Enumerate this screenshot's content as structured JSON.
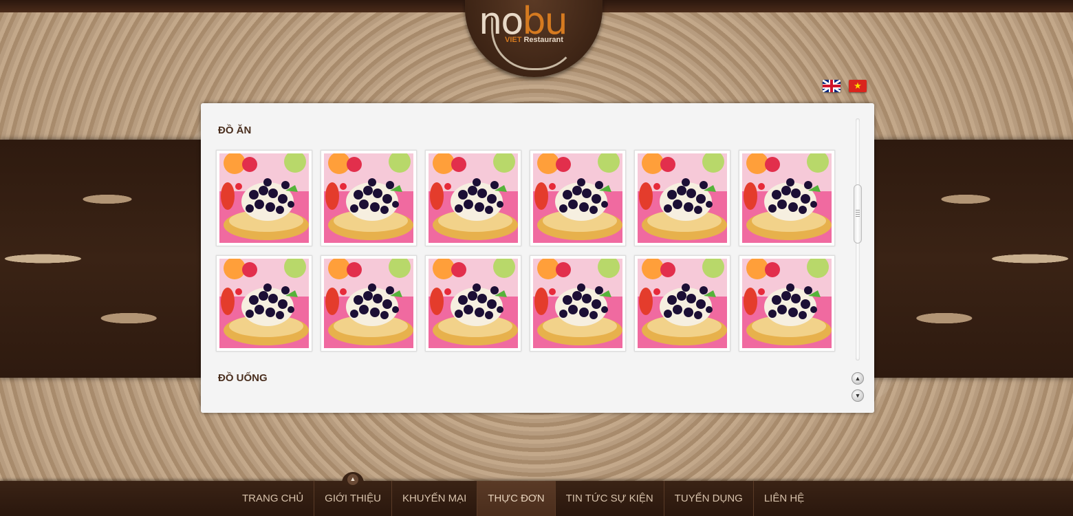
{
  "brand": {
    "logo_main_1": "no",
    "logo_main_2": "bu",
    "logo_viet": "VIET",
    "logo_restaurant": "Restaurant"
  },
  "languages": [
    {
      "name": "English",
      "icon": "uk-flag-icon"
    },
    {
      "name": "Tiếng Việt",
      "icon": "vietnam-flag-icon"
    }
  ],
  "menu_panel": {
    "section_food": "ĐỒ ĂN",
    "section_drinks": "ĐỒ UỐNG",
    "food_items_count": 12,
    "thumbnail_icon": "fruit-tart-image",
    "scroll_position": 0.45
  },
  "navigation": {
    "items": [
      "TRANG CHỦ",
      "GIỚI THIỆU",
      "KHUYẾN MẠI",
      "THỰC ĐƠN",
      "TIN TỨC SỰ KIỆN",
      "TUYỂN DỤNG",
      "LIÊN HỆ"
    ],
    "active": "THỰC ĐƠN"
  },
  "colors": {
    "brand_orange": "#d57a20",
    "dark_brown": "#3a2315",
    "panel_bg": "#f4f4f4"
  }
}
